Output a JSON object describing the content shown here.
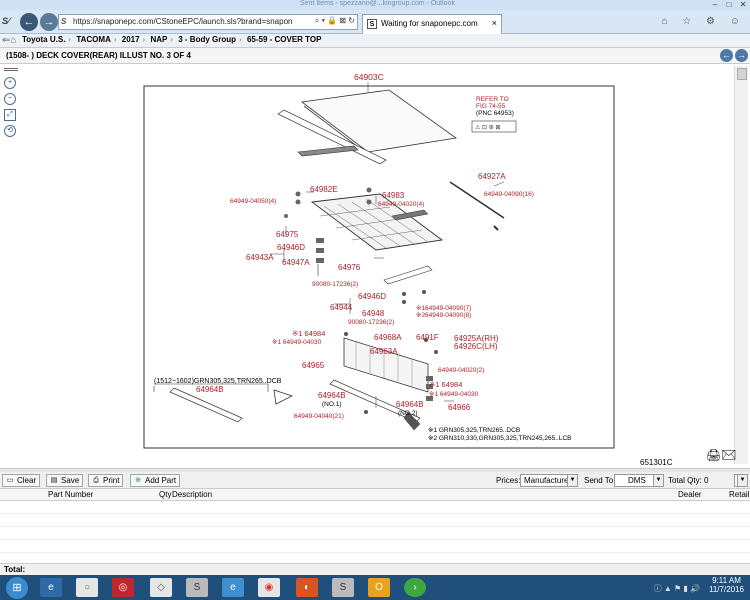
{
  "window": {
    "title_text": "Sent Items - spezzano@...kingroup.com - Outlook",
    "controls": [
      "–",
      "□",
      "✕"
    ]
  },
  "browser": {
    "url": "https://snaponepc.com/CStoneEPC/launch.sls?brand=snapon",
    "address_actions": "⌕ ▾ 🔒 ⊠ ↻",
    "tab_title": "Waiting for snaponepc.com",
    "tab_close": "×",
    "right_icons": "⌂ ☆ ⚙ ☺"
  },
  "breadcrumb": {
    "items": [
      "Toyota U.S.",
      "TACOMA",
      "2017",
      "NAP",
      "3 - Body Group",
      "65-59 - COVER TOP"
    ]
  },
  "illustration": {
    "title": "(1508- ) DECK COVER(REAR) ILLUST NO. 3 OF 4",
    "code": "651301C",
    "refer_lines": [
      "REFER TO",
      "FIG 74-55",
      "(PNC 64953)"
    ],
    "labels": {
      "p64903C": "64903C",
      "p64982E": "64982E",
      "p64949_04050": "64949-04050(4)",
      "p64983": "64983",
      "p64949_04020_4": "64949-04020(4)",
      "p64927A": "64927A",
      "p64949_04090_16": "64949-04090(16)",
      "p64975": "64975",
      "p64946D_1": "64946D",
      "p64943A": "64943A",
      "p64947A": "64947A",
      "p64976": "64976",
      "p90080_1": "90080-17236(2)",
      "p64946D_2": "64946D",
      "p64944": "64944",
      "p64948": "64948",
      "p90080_2": "90080-17236(2)",
      "p_n1_04090": "※164949-04090(7)",
      "p_n2_04090": "※264949-04090(8)",
      "p64925A": "64925A(RH)",
      "p64926C": "64926C(LH)",
      "p_n1_64984_a": "※1 64984",
      "p_n1_04030_a": "※1 64949-04030",
      "p64968A": "64968A",
      "p6491F": "6491F",
      "p64963A": "64963A",
      "p64965": "64965",
      "p64949_04020_2": "64949-04020(2)",
      "p_range": "(1512~1602)GRN305,325,TRN265..DCB",
      "p64964B": "64964B",
      "p_n1_64984_b": "※1 64984",
      "p_n1_04030_b": "※1 64949-04030",
      "p64964B_no1": "64964B",
      "p_no1": "(NO.1)",
      "p64964B_no2": "64964B",
      "p_no2": "(NO.2)",
      "p64966": "64966",
      "p64949_04040": "64949-04040(21)",
      "note1": "※1 GRN305,325,TRN265..DCB",
      "note2": "※2 GRN310,330,GRN305,325,TRN245,265..LCB"
    }
  },
  "parts": {
    "buttons": {
      "clear": "Clear",
      "save": "Save",
      "print": "Print",
      "add_part": "Add Part"
    },
    "prices_label": "Prices:",
    "prices_value": "Manufacturer",
    "sendto_label": "Send To:",
    "sendto_value": "DMS",
    "total_qty": "Total Qty: 0",
    "columns": [
      "Part Number",
      "Qty",
      "Description",
      "Dealer",
      "Retail"
    ],
    "total_label": "Total:"
  },
  "taskbar": {
    "time": "9:11 AM",
    "date": "11/7/2016",
    "tray_icons": "ⓘ ▲ ⚑ ▮ 🔊"
  },
  "colors": {
    "label_red": "#b0202a",
    "chrome_blue": "#d9e6f4",
    "taskbar": "#1f4f7a"
  }
}
